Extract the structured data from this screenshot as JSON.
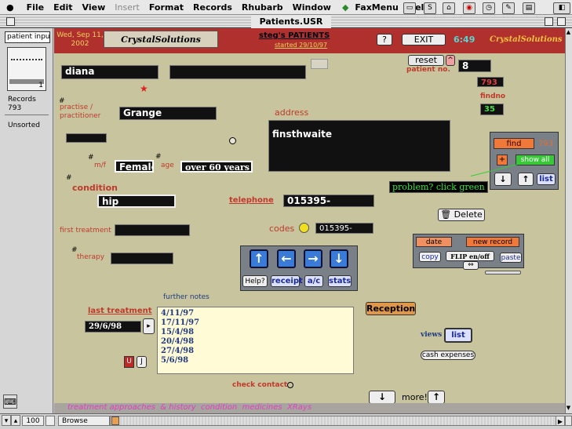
{
  "menubar": {
    "items": [
      "File",
      "Edit",
      "View",
      "Insert",
      "Format",
      "Records",
      "Rhubarb",
      "Window",
      "FaxMenu",
      "Help"
    ]
  },
  "window": {
    "title": "Patients.USR"
  },
  "sidebar": {
    "layout_popup": "patient inpu...",
    "book_page": "1",
    "records_label": "Records",
    "records_count": "793",
    "sort_status": "Unsorted"
  },
  "header": {
    "date": "Wed, Sep 11, 2002",
    "logo": "CrystalSolutions",
    "heading": "steg's PATIENTS",
    "started": "started 29/10/97",
    "help_btn": "?",
    "exit_btn": "EXIT",
    "clock": "6:49",
    "brand_right": "CrystalSolutions"
  },
  "patient": {
    "first_name": "diana",
    "second_field": "",
    "star": "★",
    "practise_label": "practise / practitioner",
    "practise_value": "Grange",
    "address_label": "address",
    "address_value": "finsthwaite",
    "mf_label": "m/f",
    "mf_value": "Female",
    "age_label": "age",
    "age_value": "over 60 years",
    "condition_label": "condition",
    "condition_value": "hip",
    "telephone_label": "telephone",
    "telephone_value": "015395-",
    "first_treatment_label": "first treatment",
    "codes_label": "codes",
    "codes_value": "015395-",
    "therapy_label": "therapy",
    "hash": "#",
    "last_treatment_label": "last treatment",
    "last_treatment_value": "29/6/98",
    "further_notes_label": "further notes",
    "notes": [
      "4/11/97",
      "17/11/97",
      "15/4/98",
      "20/4/98",
      "27/4/98",
      "5/6/98"
    ],
    "check_contact_label": "check contact"
  },
  "record": {
    "reset_btn": "reset",
    "up_btn": "^",
    "patient_no_label": "patient no.",
    "patient_no_value": "8",
    "total": "793",
    "findno_label": "findno",
    "findno_value": "35"
  },
  "find_panel": {
    "find_btn": "find",
    "find_count": "793",
    "plus_btn": "+",
    "show_all_btn": "show all",
    "down_btn": "↓",
    "up_btn": "↑",
    "list_btn": "list",
    "tip": "problem? click green"
  },
  "actions": {
    "delete_btn": "Delete",
    "date_btn": "date",
    "new_record_btn": "new record",
    "copy_btn": "copy",
    "flip_btn": "FLIP en/off",
    "paste_btn": "paste",
    "swap_btn": "⇔",
    "help_btn": "Help?",
    "receipt_btn": "receipt",
    "ac_btn": "a/c",
    "stats_btn": "stats",
    "reception_btn": "Reception",
    "views_label": "views",
    "list_btn": "list",
    "cash_btn": "cash expenses",
    "more_label": "more!",
    "u_btn": "U",
    "j_btn": "J"
  },
  "footer": {
    "links": "treatment approaches  & history  condition  medicines  XRays",
    "zoom": "100",
    "mode": "Browse"
  }
}
